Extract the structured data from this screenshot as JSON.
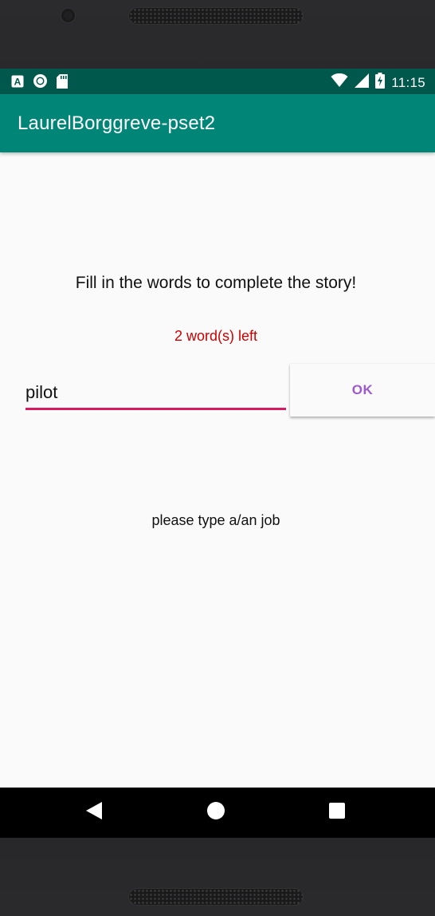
{
  "status_bar": {
    "time": "11:15",
    "left_icons": [
      "a-notification-icon",
      "circle-notification-icon",
      "sd-card-icon"
    ],
    "right_icons": [
      "wifi-icon",
      "signal-icon",
      "battery-charging-icon"
    ]
  },
  "app_bar": {
    "title": "LaurelBorggreve-pset2"
  },
  "main": {
    "instructions": "Fill in the words to complete the story!",
    "words_left": "2 word(s) left",
    "word_input": {
      "value": "pilot",
      "placeholder": ""
    },
    "ok_label": "OK",
    "hint": "please type a/an job"
  },
  "nav_bar": {
    "icons": [
      "back-icon",
      "home-icon",
      "recents-icon"
    ]
  },
  "colors": {
    "status_bar": "#00574b",
    "app_bar": "#008577",
    "accent": "#d81b60",
    "words_left": "#cc0000",
    "ok_text": "#9c59d1"
  }
}
